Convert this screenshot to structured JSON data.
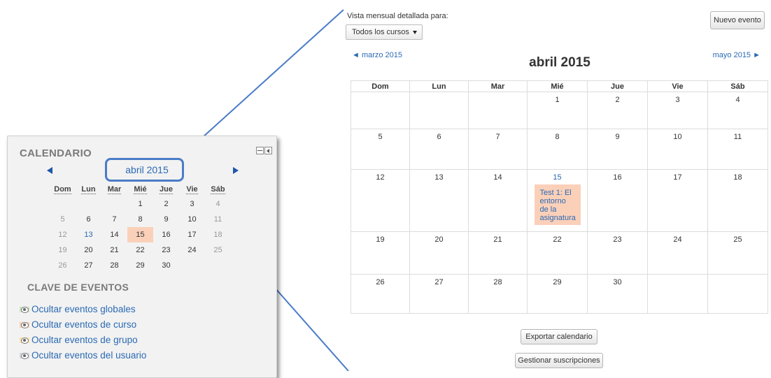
{
  "mini": {
    "title": "CALENDARIO",
    "month": "abril 2015",
    "weekdays": [
      "Dom",
      "Lun",
      "Mar",
      "Mié",
      "Jue",
      "Vie",
      "Sáb"
    ],
    "weeks": [
      [
        "",
        "",
        "",
        "1",
        "2",
        "3",
        "4"
      ],
      [
        "5",
        "6",
        "7",
        "8",
        "9",
        "10",
        "11"
      ],
      [
        "12",
        "13",
        "14",
        "15",
        "16",
        "17",
        "18"
      ],
      [
        "19",
        "20",
        "21",
        "22",
        "23",
        "24",
        "25"
      ],
      [
        "26",
        "27",
        "28",
        "29",
        "30",
        "",
        ""
      ]
    ],
    "legend_title": "CLAVE DE EVENTOS",
    "legend": [
      {
        "label": "Ocultar eventos globales",
        "color": "#c6e9bd"
      },
      {
        "label": "Ocultar eventos de curso",
        "color": "#fbd0b9"
      },
      {
        "label": "Ocultar eventos de grupo",
        "color": "#fde5a9"
      },
      {
        "label": "Ocultar eventos del usuario",
        "color": "#d4dbe4"
      }
    ]
  },
  "detail": {
    "label": "Vista mensual detallada para:",
    "select_value": "Todos los cursos",
    "new_event": "Nuevo evento",
    "prev": "◄ marzo 2015",
    "next": "mayo 2015 ►",
    "title": "abril 2015",
    "weekdays": [
      "Dom",
      "Lun",
      "Mar",
      "Mié",
      "Jue",
      "Vie",
      "Sáb"
    ],
    "weeks": [
      [
        "",
        "",
        "",
        "1",
        "2",
        "3",
        "4"
      ],
      [
        "5",
        "6",
        "7",
        "8",
        "9",
        "10",
        "11"
      ],
      [
        "12",
        "13",
        "14",
        "15",
        "16",
        "17",
        "18"
      ],
      [
        "19",
        "20",
        "21",
        "22",
        "23",
        "24",
        "25"
      ],
      [
        "26",
        "27",
        "28",
        "29",
        "30",
        "",
        ""
      ]
    ],
    "event": "Test 1: El entorno de la asignatura",
    "export": "Exportar calendario",
    "manage": "Gestionar suscripciones"
  },
  "colors": {
    "accent": "#2a6ab4",
    "event_bg": "#fbd0b9",
    "highlight": "#4a7cc7"
  }
}
